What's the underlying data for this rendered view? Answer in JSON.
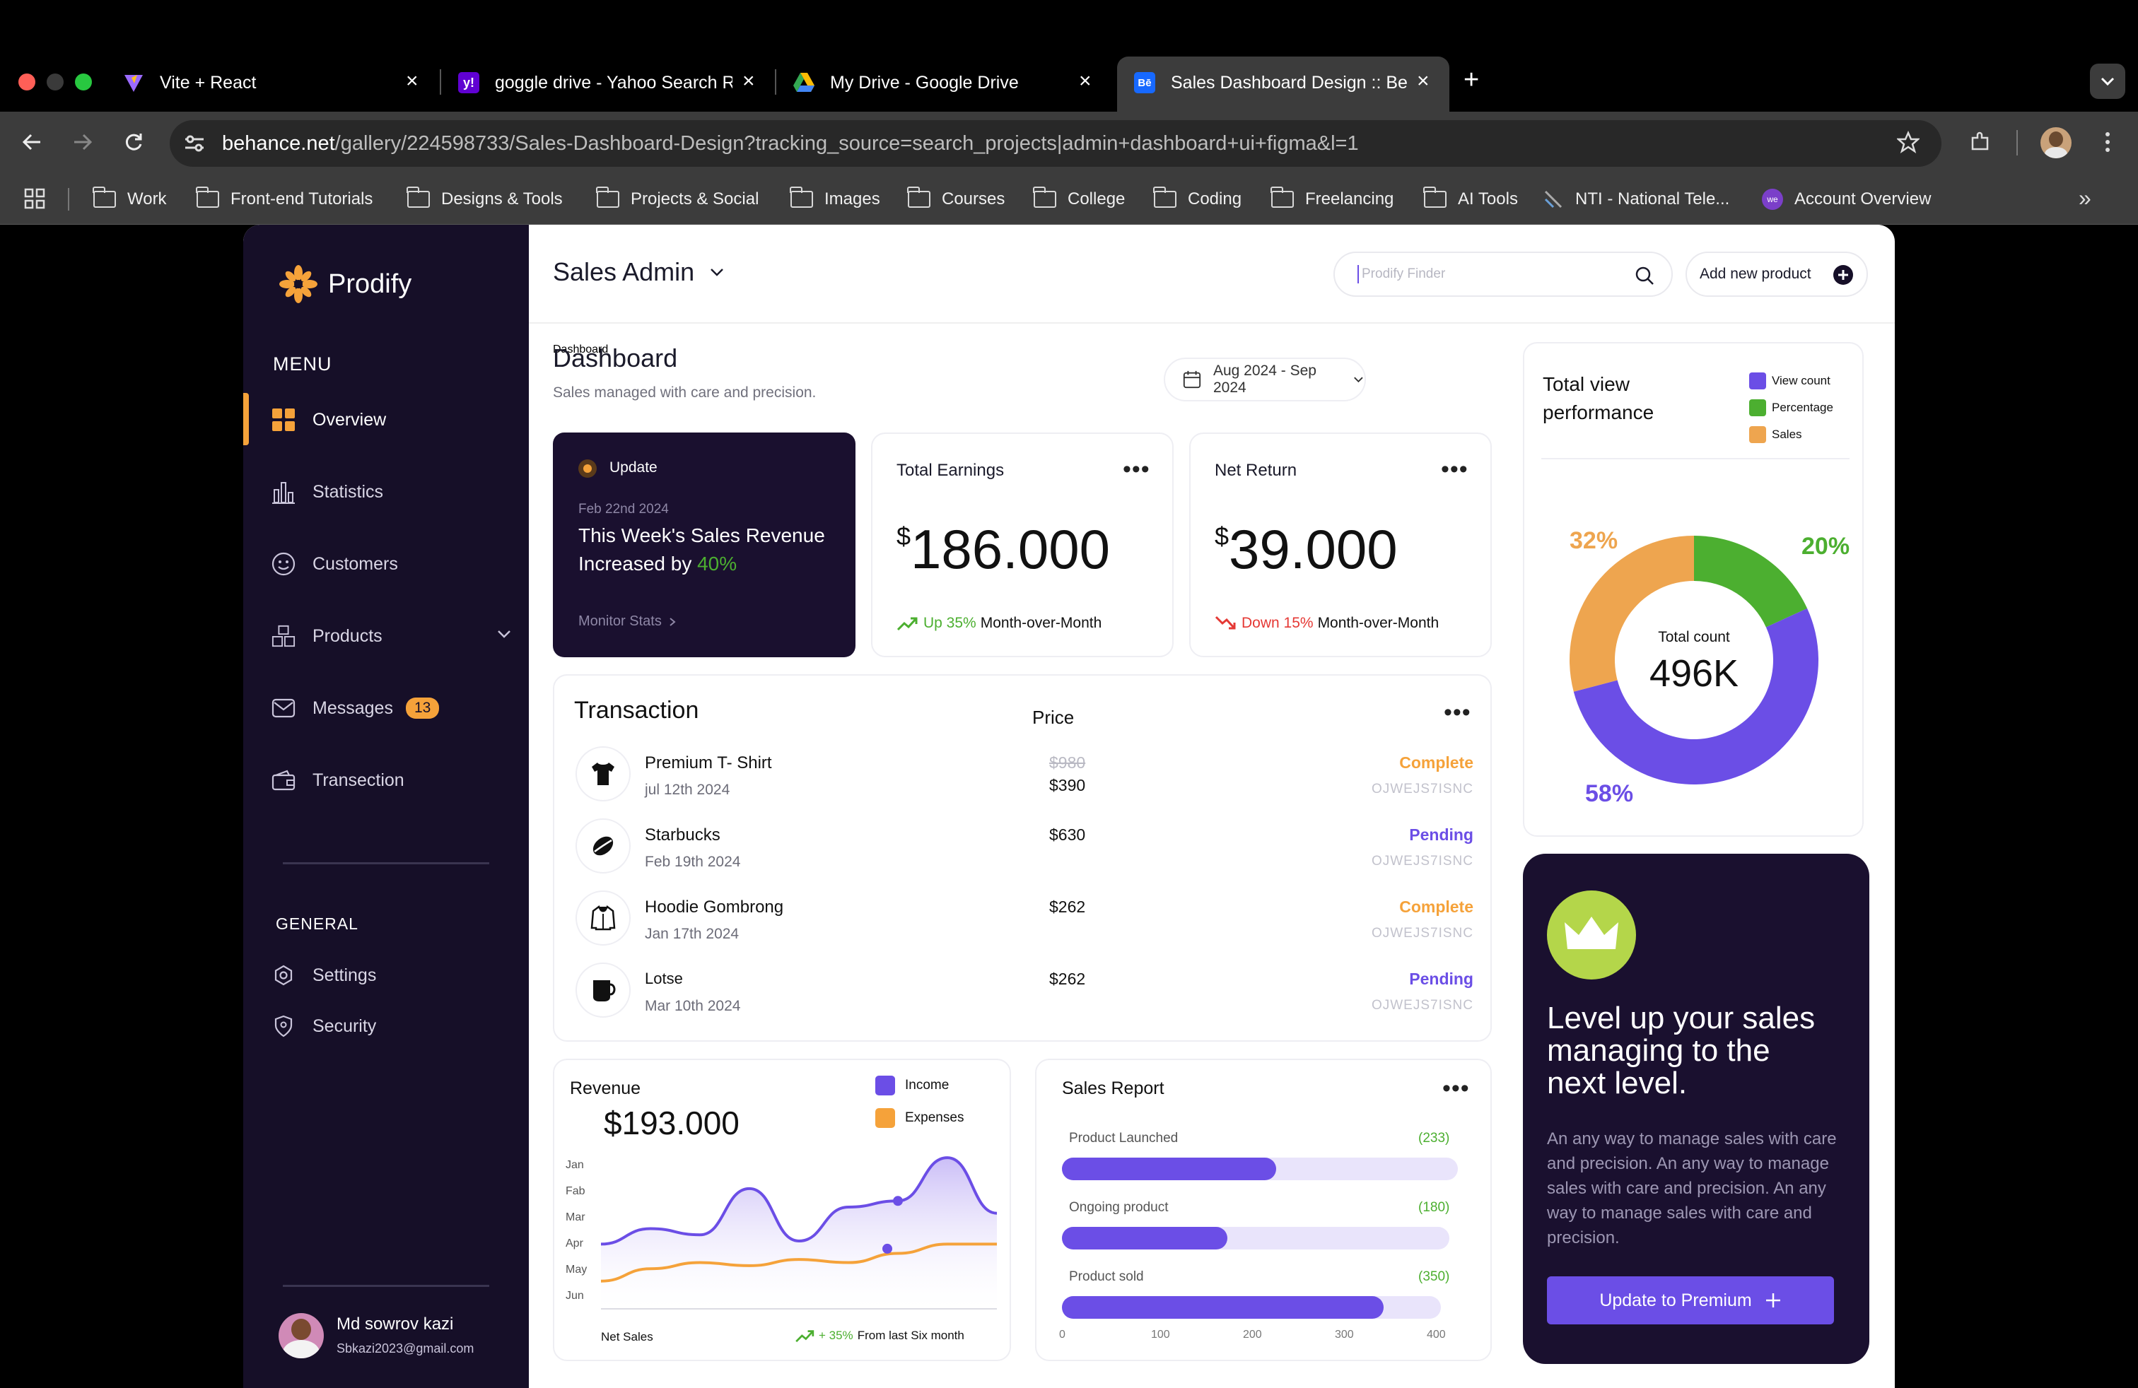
{
  "browser": {
    "tabs": [
      {
        "title": "Vite + React",
        "icon": "vite-icon"
      },
      {
        "title": "goggle drive - Yahoo Search R",
        "icon": "yahoo-icon"
      },
      {
        "title": "My Drive - Google Drive",
        "icon": "google-drive-icon"
      },
      {
        "title": "Sales Dashboard Design :: Be",
        "icon": "behance-icon",
        "active": true
      }
    ],
    "url_domain": "behance.net",
    "url_path": "/gallery/224598733/Sales-Dashboard-Design?tracking_source=search_projects|admin+dashboard+ui+figma&l=1",
    "bookmarks": [
      "Work",
      "Front-end Tutorials",
      "Designs & Tools",
      "Projects & Social",
      "Images",
      "Courses",
      "College",
      "Coding",
      "Freelancing",
      "AI Tools",
      "NTI - National Tele...",
      "Account Overview"
    ],
    "more_glyph": "»",
    "new_tab_glyph": "+"
  },
  "sidebar": {
    "brand": "Prodify",
    "menu_heading": "MENU",
    "items": [
      {
        "label": "Overview",
        "icon": "overview-grid-icon"
      },
      {
        "label": "Statistics",
        "icon": "statistics-icon"
      },
      {
        "label": "Customers",
        "icon": "smiley-icon"
      },
      {
        "label": "Products",
        "icon": "boxes-icon"
      },
      {
        "label": "Messages",
        "icon": "mail-icon",
        "badge": "13"
      },
      {
        "label": "Transection",
        "icon": "wallet-icon"
      }
    ],
    "general_heading": "GENERAL",
    "general": [
      {
        "label": "Settings",
        "icon": "settings-icon"
      },
      {
        "label": "Security",
        "icon": "shield-icon"
      }
    ],
    "user": {
      "name": "Md sowrov kazi",
      "email": "Sbkazi2023@gmail.com"
    }
  },
  "header": {
    "title": "Sales Admin",
    "search_placeholder": "Prodify Finder",
    "add_button": "Add new product"
  },
  "dashboard": {
    "title": "Dashboard",
    "subtitle": "Sales managed with care and precision.",
    "date_range": "Aug 2024 - Sep 2024",
    "update_card": {
      "tag": "Update",
      "date": "Feb 22nd 2024",
      "line1": "This Week's Sales Revenue",
      "line2_prefix": "Increased by ",
      "line2_highlight": "40%",
      "link": "Monitor Stats"
    },
    "earnings": {
      "title": "Total Earnings",
      "currency": "$",
      "value": "186.000",
      "change": "Up 35%",
      "suffix": "Month-over-Month"
    },
    "net_return": {
      "title": "Net Return",
      "currency": "$",
      "value": "39.000",
      "change": "Down 15%",
      "suffix": "Month-over-Month"
    }
  },
  "transactions": {
    "title": "Transaction",
    "price_header": "Price",
    "rows": [
      {
        "name": "Premium T- Shirt",
        "date": "jul 12th 2024",
        "old_price": "$980",
        "price": "$390",
        "status": "Complete",
        "id": "OJWEJS7ISNC",
        "icon": "tshirt-icon"
      },
      {
        "name": "Starbucks",
        "date": "Feb 19th 2024",
        "old_price": "",
        "price": "$630",
        "status": "Pending",
        "id": "OJWEJS7ISNC",
        "icon": "coffee-bean-icon"
      },
      {
        "name": "Hoodie Gombrong",
        "date": "Jan 17th 2024",
        "old_price": "",
        "price": "$262",
        "status": "Complete",
        "id": "OJWEJS7ISNC",
        "icon": "hoodie-icon"
      },
      {
        "name": "Lotse",
        "date": "Mar 10th 2024",
        "old_price": "",
        "price": "$262",
        "status": "Pending",
        "id": "OJWEJS7ISNC",
        "icon": "mug-icon"
      }
    ]
  },
  "performance": {
    "title_line1": "Total view",
    "title_line2": "performance",
    "legend": [
      "View count",
      "Percentage",
      "Sales"
    ],
    "center_label": "Total count",
    "center_value": "496K",
    "labels": [
      "32%",
      "20%",
      "58%"
    ]
  },
  "revenue": {
    "title": "Revenue",
    "value": "$193.000",
    "legend": [
      "Income",
      "Expenses"
    ],
    "months": [
      "Jan",
      "Fab",
      "Mar",
      "Apr",
      "May",
      "Jun"
    ],
    "footer_left": "Net Sales",
    "footer_right_highlight": "+ 35%",
    "footer_right": "From last Six month"
  },
  "sales_report": {
    "title": "Sales Report",
    "bars": [
      {
        "label": "Product Launched",
        "count": "(233)",
        "value": 233
      },
      {
        "label": "Ongoing product",
        "count": "(180)",
        "value": 180
      },
      {
        "label": "Product sold",
        "count": "(350)",
        "value": 350
      }
    ],
    "axis": [
      "0",
      "100",
      "200",
      "300",
      "400"
    ]
  },
  "promo": {
    "headline_1": "Level up your sales",
    "headline_2": "managing to the",
    "headline_3": "next level.",
    "body": "An any way to manage sales with care and precision. An any way to manage sales with care and precision. An any way to manage sales with care and precision.",
    "button": "Update to Premium"
  },
  "colors": {
    "accent_orange": "#f5a23a",
    "accent_purple": "#6b4ee6",
    "green": "#4caf30",
    "red": "#e53935",
    "sidebar_bg": "#160f28"
  },
  "chart_data": [
    {
      "type": "pie",
      "title": "Total view performance",
      "categories": [
        "View count",
        "Percentage",
        "Sales"
      ],
      "values": [
        58,
        20,
        32
      ],
      "colors": [
        "#6b4ee6",
        "#4caf30",
        "#eea54f"
      ]
    },
    {
      "type": "line",
      "title": "Revenue",
      "x": [
        "Jan",
        "Fab",
        "Mar",
        "Apr",
        "May",
        "Jun"
      ],
      "series": [
        {
          "name": "Income",
          "values": [
            42,
            52,
            48,
            78,
            44,
            66,
            70,
            98,
            62
          ]
        },
        {
          "name": "Expenses",
          "values": [
            18,
            26,
            30,
            28,
            32,
            30,
            36,
            42,
            42
          ]
        }
      ]
    },
    {
      "type": "bar",
      "title": "Sales Report",
      "categories": [
        "Product Launched",
        "Ongoing product",
        "Product sold"
      ],
      "values": [
        233,
        180,
        350
      ],
      "xlim": [
        0,
        400
      ]
    }
  ]
}
